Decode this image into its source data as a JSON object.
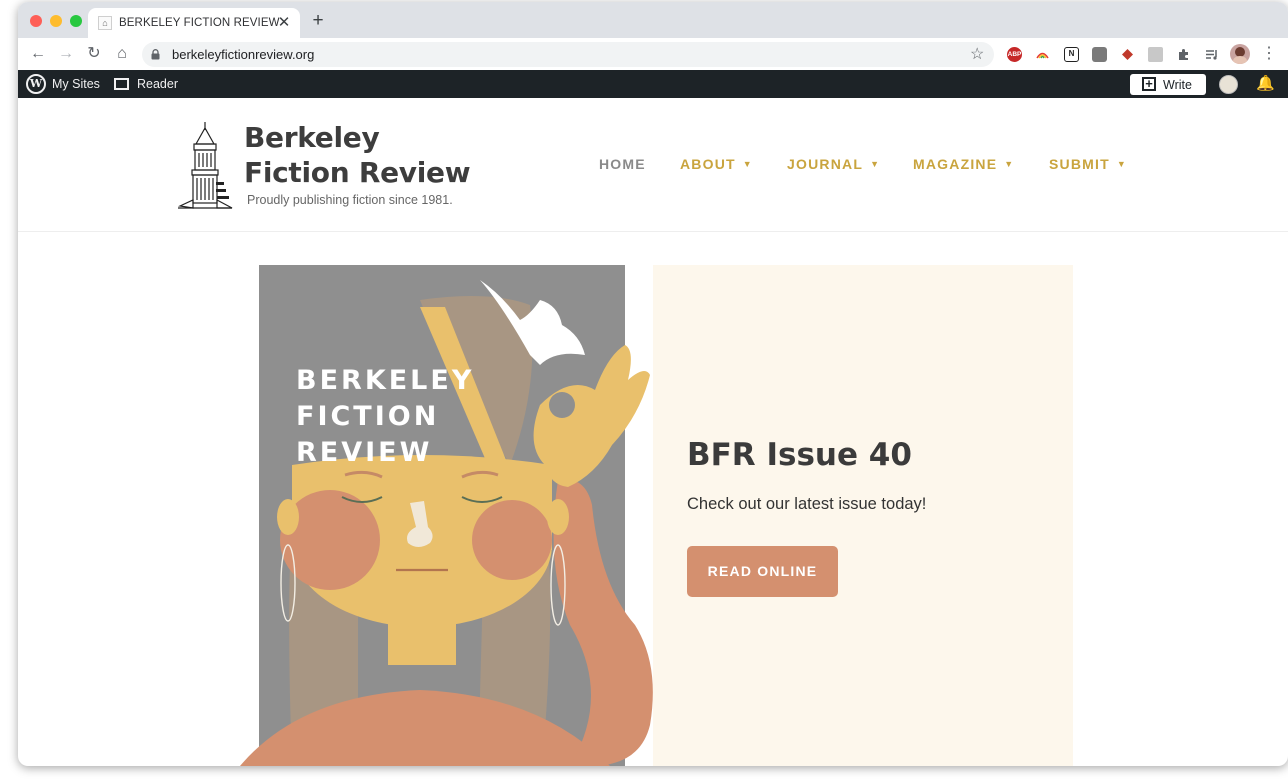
{
  "browser": {
    "tab": {
      "title": "BERKELEY FICTION REVIEW"
    },
    "new_tab_symbol": "+",
    "close_symbol": "✕",
    "url": "berkeleyfictionreview.org",
    "extensions": [
      "abp-icon",
      "rainbow-icon",
      "notion-icon",
      "mint-icon",
      "red-arrow-icon",
      "paste-icon",
      "puzzle-icon",
      "media-icon",
      "profile-avatar"
    ],
    "extension_labels": {
      "abp": "ABP",
      "notion": "N"
    }
  },
  "wp_admin_bar": {
    "my_sites": "My Sites",
    "reader": "Reader",
    "write": "Write",
    "logo_letter": "W"
  },
  "site": {
    "title_line1": "Berkeley",
    "title_line2": "Fiction Review",
    "tagline": "Proudly publishing fiction since 1981.",
    "nav": [
      {
        "label": "HOME",
        "dropdown": false
      },
      {
        "label": "ABOUT",
        "dropdown": true
      },
      {
        "label": "JOURNAL",
        "dropdown": true
      },
      {
        "label": "MAGAZINE",
        "dropdown": true
      },
      {
        "label": "SUBMIT",
        "dropdown": true
      }
    ],
    "nav_chevron": "⌄"
  },
  "hero": {
    "cover_text": [
      "BERKELEY",
      "FICTION",
      "REVIEW"
    ],
    "title": "BFR Issue 40",
    "subtitle": "Check out our latest issue today!",
    "button": "READ ONLINE"
  },
  "colors": {
    "accent_gold": "#c9a43e",
    "button_terracotta": "#d4906f",
    "promo_bg": "#fdf7ec",
    "cover_gray": "#8f8f8f",
    "skin_yellow": "#e9c06c"
  }
}
